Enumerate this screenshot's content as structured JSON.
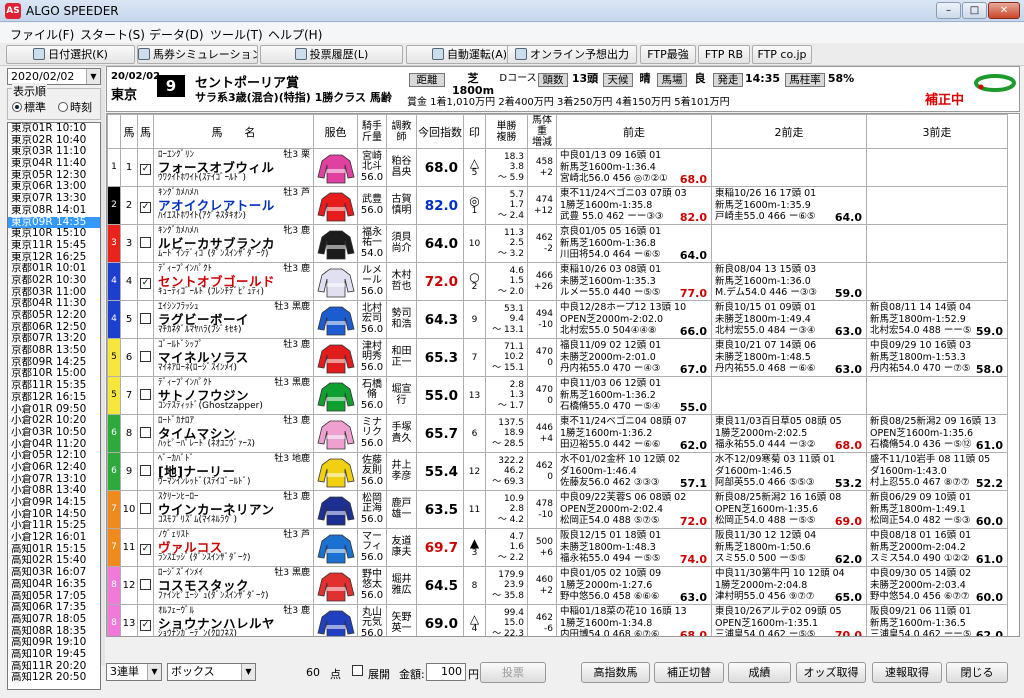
{
  "window": {
    "title": "ALGO SPEEDER",
    "logo": "AS"
  },
  "menu": [
    "ファイル(F)",
    "スタート(S)",
    "データ(D)",
    "ツール(T)",
    "ヘルプ(H)"
  ],
  "toolbar": [
    "日付選択(K)",
    "馬券シミュレーション(B)",
    "投票履歴(L)",
    "自動運転(A)",
    "オンライン予想出力",
    "FTP最強",
    "FTP RB",
    "FTP co.jp"
  ],
  "left": {
    "date": "2020/02/02",
    "display_order_label": "表示順",
    "opt_standard": "標準",
    "opt_time": "時刻",
    "races": [
      "東京01R 10:10",
      "東京02R 10:40",
      "東京03R 11:10",
      "東京04R 11:40",
      "東京05R 12:30",
      "東京06R 13:00",
      "東京07R 13:30",
      "東京08R 14:01",
      "東京09R 14:35",
      "東京10R 15:10",
      "東京11R 15:45",
      "東京12R 16:25",
      "京都01R 10:01",
      "京都02R 10:30",
      "京都03R 11:00",
      "京都04R 11:30",
      "京都05R 12:20",
      "京都06R 12:50",
      "京都07R 13:20",
      "京都08R 13:50",
      "京都09R 14:25",
      "京都10R 15:00",
      "京都11R 15:35",
      "京都12R 16:15",
      "小倉01R 09:50",
      "小倉02R 10:20",
      "小倉03R 10:50",
      "小倉04R 11:20",
      "小倉05R 12:10",
      "小倉06R 12:40",
      "小倉07R 13:10",
      "小倉08R 13:40",
      "小倉09R 14:15",
      "小倉10R 14:50",
      "小倉11R 15:25",
      "小倉12R 16:01",
      "高知01R 15:15",
      "高知02R 15:40",
      "高知03R 16:07",
      "高知04R 16:35",
      "高知05R 17:05",
      "高知06R 17:35",
      "高知07R 18:05",
      "高知08R 18:35",
      "高知09R 19:10",
      "高知10R 19:45",
      "高知11R 20:20",
      "高知12R 20:50"
    ],
    "selected_index": 8
  },
  "race": {
    "date": "20/02/02",
    "venue": "東京",
    "num": "9",
    "name": "セントポーリア賞",
    "cond": "サラ系3歳(混合)(特指)  1勝クラス  馬齢",
    "prize": "賞金  1着1,010万円   2着400万円   3着250万円   4着150万円   5着101万円",
    "dist_lbl": "距離",
    "dist": "芝1800m",
    "course": "Dコース",
    "heads_lbl": "頭数",
    "heads": "13頭",
    "weather_lbl": "天候",
    "weather": "晴",
    "track_lbl": "馬場",
    "going": "良",
    "start_lbl": "発走",
    "start": "14:35",
    "rate_lbl": "馬柱率",
    "rate": "58%",
    "hosei": "補正中"
  },
  "columns": [
    "馬",
    "馬",
    "馬　　名",
    "服色",
    "騎手\n斤量",
    "調教\n師",
    "今回指数",
    "印",
    "単勝\n複勝",
    "馬体重\n増減",
    "前走",
    "2前走",
    "3前走"
  ],
  "horses": [
    {
      "waku": "1",
      "wc": "#ffffff",
      "wt": "#000",
      "no": "1",
      "chk": true,
      "sire": "ﾛｰｴﾝｸﾞﾘﾝ",
      "name": "フォースオブウィル",
      "dam": "ｳﾜｸｲﾄﾎﾜｲﾄ(ｽﾃｲｺﾞｰﾙﾄﾞ)",
      "sex": "牡3 栗",
      "jockey": "宮崎北斗",
      "kg": "56.0",
      "trainer": "粕谷昌央",
      "index": "68.0",
      "ic": "",
      "mark": "△",
      "mrank": "5",
      "ow": "18.3",
      "op": "3.8",
      "pr": "～  5.9",
      "bw": "458",
      "bd": "+2",
      "p1": [
        "中良01/13         09 16頭 01",
        "新馬芝1600m-1:36.4",
        "宮崎北56.0 456 ◎⑦②①",
        "68.0"
      ],
      "p2": [
        "",
        "",
        "",
        ""
      ],
      "p3": [
        "",
        "",
        "",
        ""
      ]
    },
    {
      "waku": "2",
      "wc": "#000000",
      "wt": "#fff",
      "no": "2",
      "chk": true,
      "sire": "ｷﾝｸﾞｶﾒﾊﾒﾊ",
      "name": "アオイクレアトール",
      "dam": "ﾊｲｴｽﾄﾎﾜｲﾄ(ｱｸﾞﾈｽﾀｷｵﾝ)",
      "sex": "牡3 芦",
      "jockey": "武豊",
      "kg": "56.0",
      "trainer": "古賀慎明",
      "index": "82.0",
      "ic": "blue",
      "mark": "◎",
      "mrank": "1",
      "ow": "5.7",
      "op": "1.7",
      "pr": "～  2.4",
      "bw": "474",
      "bd": "+12",
      "p1": [
        "東不11/24ベゴニ03 07頭 03",
        "1勝芝1600m-1:35.8",
        "武豊 55.0 462 ーー③③",
        "82.0"
      ],
      "p2": [
        "東稲10/26      16 17頭 01",
        "新馬芝1600m-1:35.9",
        "戸崎圭55.0 466 ー⑥⑤",
        "64.0"
      ],
      "p3": [
        "",
        "",
        "",
        ""
      ]
    },
    {
      "waku": "3",
      "wc": "#e8241c",
      "wt": "#fff",
      "no": "3",
      "chk": false,
      "sire": "ｷﾝｸﾞｶﾒﾊﾒﾊ",
      "name": "ルビーカサブランカ",
      "dam": "ﾑｰﾄﾞｲﾝﾃﾞｨｺﾞ(ﾀﾞﾝｽｲﾝｻﾞﾀﾞｰｸ)",
      "sex": "牝3 鹿",
      "jockey": "福永祐一",
      "kg": "54.0",
      "trainer": "須貝尚介",
      "index": "64.0",
      "ic": "",
      "mark": "",
      "mrank": "10",
      "ow": "11.3",
      "op": "2.5",
      "pr": "～  3.2",
      "bw": "462",
      "bd": "-2",
      "p1": [
        "京良01/05         05 16頭 01",
        "新馬芝1600m-1:36.8",
        "川田将54.0 464 ー⑥⑤",
        "64.0"
      ],
      "p2": [
        "",
        "",
        "",
        ""
      ],
      "p3": [
        "",
        "",
        "",
        ""
      ]
    },
    {
      "waku": "4",
      "wc": "#1c3fd0",
      "wt": "#fff",
      "no": "4",
      "chk": true,
      "sire": "ﾃﾞｨｰﾌﾟｲﾝﾊﾟｸﾄ",
      "name": "セントオブゴールド",
      "dam": "ｷｭｰﾃｨｺﾞｰﾙﾄﾞ(ﾌﾚﾝﾁﾃﾞﾋﾟｭﾃｨ)",
      "sex": "牡3 鹿",
      "jockey": "ルメール",
      "kg": "56.0",
      "trainer": "木村哲也",
      "index": "72.0",
      "ic": "red",
      "mark": "○",
      "mrank": "2",
      "ow": "4.6",
      "op": "1.5",
      "pr": "～  2.0",
      "bw": "466",
      "bd": "+26",
      "p1": [
        "東稲10/26         03 08頭 01",
        "未勝芝1600m-1:35.3",
        "ルメー55.0 440 ー⑤⑤",
        "77.0"
      ],
      "p2": [
        "新良08/04      13 15頭 03",
        "新馬芝1600m-1:36.0",
        "M.デム54.0 446 ー③③",
        "59.0"
      ],
      "p3": [
        "",
        "",
        "",
        ""
      ]
    },
    {
      "waku": "4",
      "wc": "#1c3fd0",
      "wt": "#fff",
      "no": "5",
      "chk": false,
      "sire": "ｴｲｼﾝﾌﾗｯｼｭ",
      "name": "ラグビーボーイ",
      "dam": "ﾏﾁｶﾈﾀﾞﾙﾏﾔﾊﾗ(ﾌｼﾞｷｾｷ)",
      "sex": "牡3 黒鹿",
      "jockey": "北村宏司",
      "kg": "56.0",
      "trainer": "勢司和浩",
      "index": "64.3",
      "ic": "",
      "mark": "",
      "mrank": "9",
      "ow": "53.1",
      "op": "9.4",
      "pr": "～  13.1",
      "bw": "494",
      "bd": "-10",
      "p1": [
        "中良12/28ホープ12 13頭 10",
        "OPEN芝2000m-2:02.0",
        "北村宏55.0 504④④⑧",
        "66.0"
      ],
      "p2": [
        "新良10/15      01 09頭 01",
        "未勝芝1800m-1:49.4",
        "北村宏55.0 484 ー③④",
        "63.0"
      ],
      "p3": [
        "新良08/11      14 14頭 04",
        "新馬芝1800m-1:52.9",
        "北村宏54.0 488 ーー⑤",
        "59.0"
      ]
    },
    {
      "waku": "5",
      "wc": "#f7e63c",
      "wt": "#000",
      "no": "6",
      "chk": false,
      "sire": "ｺﾞｰﾙﾄﾞｼｯﾌﾟ",
      "name": "マイネルソラス",
      "dam": "ﾏｲﾈｱﾛｰﾈ(ﾛｰｼﾞｽｲﾝﾒｲ)",
      "sex": "牡3 鹿",
      "jockey": "津村明秀",
      "kg": "56.0",
      "trainer": "和田正一",
      "index": "65.3",
      "ic": "",
      "mark": "",
      "mrank": "7",
      "ow": "71.1",
      "op": "10.2",
      "pr": "～  15.1",
      "bw": "470",
      "bd": "0",
      "p1": [
        "福良11/09         02 12頭 01",
        "未勝芝2000m-2:01.0",
        "丹内祐55.0 470 ー④③",
        "67.0"
      ],
      "p2": [
        "東良10/21      07 14頭 06",
        "未勝芝1800m-1:48.5",
        "丹内祐55.0 468 ー⑥⑥",
        "63.0"
      ],
      "p3": [
        "中良09/29      10 16頭 03",
        "新馬芝1800m-1:53.3",
        "丹内祐54.0 470 ー⑦⑤",
        "58.0"
      ]
    },
    {
      "waku": "5",
      "wc": "#f7e63c",
      "wt": "#000",
      "no": "7",
      "chk": false,
      "sire": "ﾃﾞｨｰﾌﾟｲﾝﾊﾟｸﾄ",
      "name": "サトノフウジン",
      "dam": "ｺﾝﾃｽﾃｨｯﾄﾞ(Ghostzapper)",
      "sex": "牡3 黒鹿",
      "jockey": "石橋脩",
      "kg": "56.0",
      "trainer": "堀宣行",
      "index": "55.0",
      "ic": "",
      "mark": "",
      "mrank": "13",
      "ow": "2.8",
      "op": "1.3",
      "pr": "～  1.7",
      "bw": "470",
      "bd": "0",
      "p1": [
        "中良11/03         06 12頭 01",
        "新馬芝1600m-1:36.2",
        "石橋脩55.0 470 ー⑤④",
        "55.0"
      ],
      "p2": [
        "",
        "",
        "",
        ""
      ],
      "p3": [
        "",
        "",
        "",
        ""
      ]
    },
    {
      "waku": "6",
      "wc": "#2eaa3c",
      "wt": "#fff",
      "no": "8",
      "chk": false,
      "sire": "ﾛｰﾄﾞｶﾅﾛｱ",
      "name": "タイムマシン",
      "dam": "ﾊｯﾋﾟｰﾊﾟﾚｰﾄﾞ(ﾈｵﾕﾆｳﾞｧｰｽ)",
      "sex": "牡3 鹿",
      "jockey": "ミナリク",
      "kg": "56.0",
      "trainer": "手塚貴久",
      "index": "65.7",
      "ic": "",
      "mark": "",
      "mrank": "6",
      "ow": "137.5",
      "op": "18.9",
      "pr": "～  28.5",
      "bw": "446",
      "bd": "+4",
      "p1": [
        "東不11/24ベゴニ04 08頭 07",
        "1勝芝1600m-1:36.2",
        "田辺裕55.0 442 ー⑥⑥",
        "62.0"
      ],
      "p2": [
        "東良11/03百日草05 08頭 05",
        "1勝芝2000m-2:02.5",
        "福永祐55.0 444 ー③②",
        "68.0"
      ],
      "p3": [
        "新良08/25新潟2 09 16頭 13",
        "OPEN芝1600m-1:35.6",
        "石橋脩54.0 436 ー⑤⑫",
        "61.0"
      ]
    },
    {
      "waku": "6",
      "wc": "#2eaa3c",
      "wt": "#fff",
      "no": "9",
      "chk": false,
      "sire": "ﾍﾞｰｶﾊﾞﾄﾞ",
      "name": "[地]ナーリー",
      "dam": "ｳｰﾏﾝｲﾝﾚｯﾄﾞ(ｽﾃｲｺﾞｰﾙﾄﾞ)",
      "sex": "牡3 地鹿",
      "jockey": "佐藤友則",
      "kg": "56.0",
      "trainer": "井上孝彦",
      "index": "55.4",
      "ic": "",
      "mark": "",
      "mrank": "12",
      "ow": "322.2",
      "op": "46.2",
      "pr": "～  69.3",
      "bw": "462",
      "bd": "0",
      "p1": [
        "水不01/02金杯 10 12頭 02",
        "ダ1600m-1:46.4",
        "佐藤友56.0 462 ③③③",
        "57.1"
      ],
      "p2": [
        "水不12/09寒菊 03 11頭 01",
        "ダ1600m-1:46.5",
        "阿部英55.0 466 ⑤⑤③",
        "53.2"
      ],
      "p3": [
        "盛不11/10岩手 08 11頭 05",
        "ダ1600m-1:43.0",
        "村上忍55.0 467 ⑧⑦⑦",
        "52.2"
      ]
    },
    {
      "waku": "7",
      "wc": "#f08a1c",
      "wt": "#fff",
      "no": "10",
      "chk": false,
      "sire": "ｽｸﾘｰﾝﾋｰﾛｰ",
      "name": "ウインカーネリアン",
      "dam": "ｺｽﾓﾌﾟﾘｽﾞﾑ(ﾏｲﾈﾙﾗｳﾞ)",
      "sex": "牡3 鹿",
      "jockey": "松岡正海",
      "kg": "56.0",
      "trainer": "鹿戸雄一",
      "index": "63.5",
      "ic": "",
      "mark": "",
      "mrank": "11",
      "ow": "10.9",
      "op": "2.8",
      "pr": "～  4.2",
      "bw": "478",
      "bd": "-10",
      "p1": [
        "中良09/22芙蓉S 06 08頭 02",
        "OPEN芝2000m-2:02.4",
        "松岡正54.0 488 ⑤⑦⑤",
        "72.0"
      ],
      "p2": [
        "新良08/25新潟2 16 16頭 08",
        "OPEN芝1600m-1:35.6",
        "松岡正54.0 488 ー⑤⑤",
        "69.0"
      ],
      "p3": [
        "新良06/29      09 10頭 01",
        "新馬芝1800m-1:49.1",
        "松岡正54.0 482 ー⑤③",
        "60.0"
      ]
    },
    {
      "waku": "7",
      "wc": "#f08a1c",
      "wt": "#fff",
      "no": "11",
      "chk": true,
      "sire": "ﾉｳﾞｪﾘｽﾄ",
      "name": "ヴァルコス",
      "dam": "ﾗﾝｽｴｯｼﾞ(ﾀﾞﾝｽｲﾝｻﾞﾀﾞｰｸ)",
      "sex": "牡3 芦",
      "jockey": "マーフィ",
      "kg": "56.0",
      "trainer": "友道康夫",
      "index": "69.7",
      "ic": "red",
      "mark": "▲",
      "mrank": "3",
      "ow": "4.7",
      "op": "1.6",
      "pr": "～  2.2",
      "bw": "500",
      "bd": "+6",
      "p1": [
        "阪良12/15         01 18頭 01",
        "未勝芝1800m-1:48.3",
        "福永祐55.0 494 ー⑤⑤",
        "74.0"
      ],
      "p2": [
        "阪良11/30      12 12頭 04",
        "新馬芝1800m-1:50.6",
        "スミ55.0 500 ー⑤⑤",
        "62.0"
      ],
      "p3": [
        "中良08/18      01 16頭 01",
        "新馬芝2000m-2:04.2",
        "スミス54.0 490 ①②②",
        "61.0"
      ]
    },
    {
      "waku": "8",
      "wc": "#f07ad8",
      "wt": "#fff",
      "no": "12",
      "chk": false,
      "sire": "ﾛｰｼﾞｽﾞｲﾝﾒｲ",
      "name": "コスモスタック",
      "dam": "ﾌｧｲﾝﾋﾟｴｰｼﾞｭ(ﾀﾞﾝｽｲﾝｻﾞﾀﾞｰｸ)",
      "sex": "牡3 黒鹿",
      "jockey": "野中悠太",
      "kg": "56.0",
      "trainer": "堀井雅広",
      "index": "64.5",
      "ic": "",
      "mark": "",
      "mrank": "8",
      "ow": "179.9",
      "op": "23.9",
      "pr": "～  35.8",
      "bw": "460",
      "bd": "+2",
      "p1": [
        "中良01/05         02 10頭 09",
        "1勝芝2000m-1:27.6",
        "野中悠56.0 458 ⑥⑥⑥",
        "63.0"
      ],
      "p2": [
        "中良11/30第牛円 10 12頭 04",
        "1勝芝2000m-2:04.8",
        "津村明55.0 456 ⑨⑦⑦",
        "65.0"
      ],
      "p3": [
        "中良09/30      05 14頭 02",
        "未勝芝2000m-2:03.4",
        "野中悠54.0 456 ⑥⑦⑦",
        "60.0"
      ]
    },
    {
      "waku": "8",
      "wc": "#f07ad8",
      "wt": "#fff",
      "no": "13",
      "chk": true,
      "sire": "ｵﾙﾌｪｰｳﾞﾙ",
      "name": "ショウナンハレルヤ",
      "dam": "ｼｮｳﾅﾝｶﾞｰﾃﾞﾝ(ｸﾛﾌﾈｽ)",
      "sex": "牡3 鹿",
      "jockey": "丸山元気",
      "kg": "56.0",
      "trainer": "矢野英一",
      "index": "69.0",
      "ic": "",
      "mark": "△",
      "mrank": "4",
      "ow": "99.4",
      "op": "15.0",
      "pr": "～  22.3",
      "bw": "462",
      "bd": "-6",
      "p1": [
        "中稲01/18菜の花10 16頭 13",
        "1勝芝1600m-1:34.8",
        "内田博54.0 468 ⑥⑦⑥",
        "68.0"
      ],
      "p2": [
        "東良10/26アルテ02 09頭 05",
        "OPEN芝1600m-1:35.1",
        "三浦皇54.0 462 ー⑤⑤",
        "70.0"
      ],
      "p3": [
        "阪良09/21      06 11頭 01",
        "新馬芝1600m-1:36.5",
        "三浦皇54.0 462 ーー⑤",
        "62.0"
      ]
    }
  ],
  "bottom": {
    "bet_type": "3連単",
    "mode": "ボックス",
    "points": "60",
    "points_unit": "点",
    "expand_label": "展開",
    "amount_label": "金額:",
    "amount": "100",
    "yen": "円",
    "vote": "投票",
    "buttons": [
      "高指数馬",
      "補正切替",
      "成績",
      "オッズ取得",
      "速報取得",
      "閉じる"
    ]
  }
}
